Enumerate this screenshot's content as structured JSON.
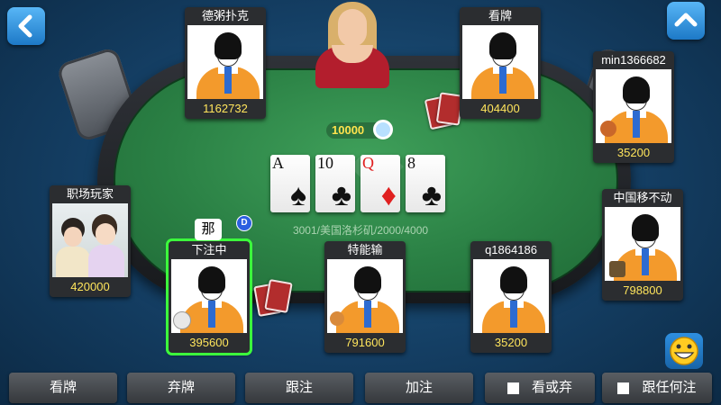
{
  "table": {
    "info": "3001/美国洛杉矶/2000/4000",
    "pot": "10000"
  },
  "community_cards": [
    {
      "rank": "A",
      "suit": "♠",
      "color": "black"
    },
    {
      "rank": "10",
      "suit": "♣",
      "color": "black"
    },
    {
      "rank": "Q",
      "suit": "♦",
      "color": "red"
    },
    {
      "rank": "8",
      "suit": "♣",
      "color": "black"
    }
  ],
  "players": {
    "top_left": {
      "name": "德粥扑克",
      "chips": "1162732"
    },
    "top_right": {
      "name": "看牌",
      "chips": "404400"
    },
    "right_top": {
      "name": "min1366682",
      "chips": "35200"
    },
    "left_mid": {
      "name": "职场玩家",
      "chips": "420000"
    },
    "right_mid": {
      "name": "中国移不动",
      "chips": "798800"
    },
    "bottom_1": {
      "name": "下注中",
      "chips": "395600"
    },
    "bottom_2": {
      "name": "特能输",
      "chips": "791600"
    },
    "bottom_3": {
      "name": "q1864186",
      "chips": "35200"
    }
  },
  "chat_bubble": "那",
  "dealer_button": "D",
  "actions": {
    "check": "看牌",
    "fold": "弃牌",
    "call": "跟注",
    "raise": "加注",
    "check_or_fold": "看或弃",
    "call_any": "跟任何注"
  },
  "icons": {
    "back": "back-arrow-icon",
    "collapse": "chevron-up-icon",
    "emoji": "smiley-icon"
  }
}
